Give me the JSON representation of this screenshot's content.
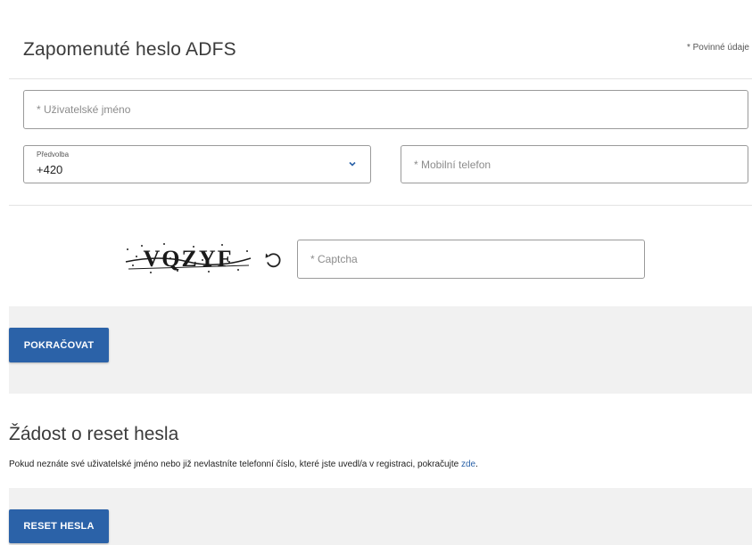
{
  "form": {
    "title": "Zapomenuté heslo ADFS",
    "required_note": "* Povinné údaje",
    "username": {
      "placeholder": "* Uživatelské jméno"
    },
    "prefix": {
      "label": "Předvolba",
      "value": "+420"
    },
    "mobile": {
      "placeholder": "* Mobilní telefon"
    },
    "captcha": {
      "image_text": "VQZYF",
      "placeholder": "* Captcha"
    },
    "continue_label": "POKRAČOVAT"
  },
  "reset": {
    "title": "Žádost o reset hesla",
    "text": "Pokud neznáte své uživatelské jméno nebo již nevlastníte telefonní číslo, které jste uvedl/a v registraci, pokračujte ",
    "link": "zde",
    "text_end": ".",
    "button_label": "RESET HESLA"
  },
  "colors": {
    "accent": "#2b62a8",
    "band": "#f1f1f1"
  }
}
